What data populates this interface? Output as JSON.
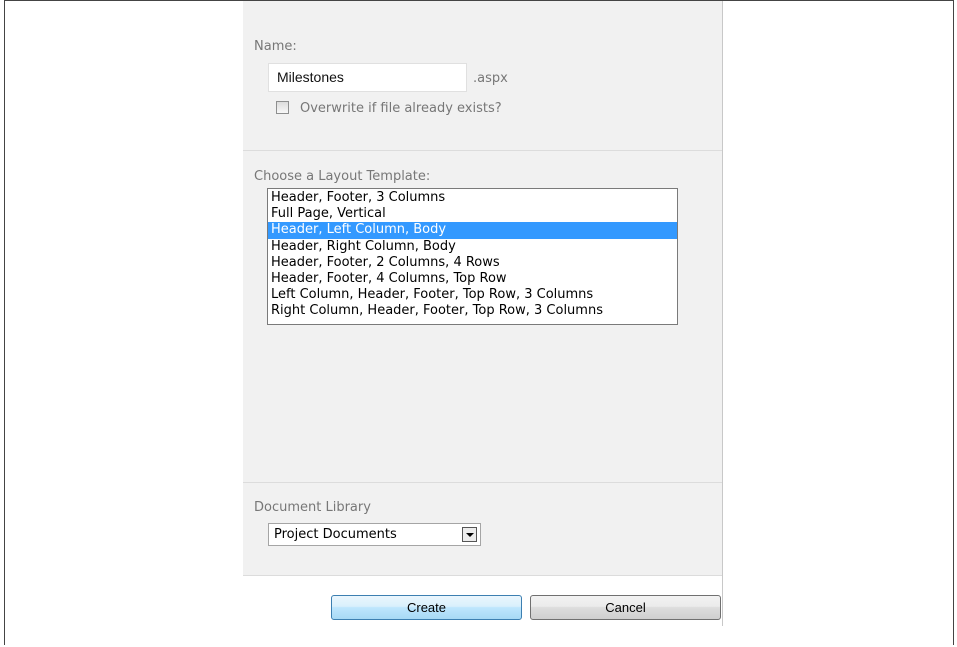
{
  "form": {
    "name_label": "Name:",
    "name_value": "Milestones",
    "extension": ".aspx",
    "overwrite_label": "Overwrite if file already exists?",
    "overwrite_checked": false
  },
  "layout": {
    "label": "Choose a Layout Template:",
    "options": [
      "Header, Footer, 3 Columns",
      "Full Page, Vertical",
      "Header, Left Column, Body",
      "Header, Right Column, Body",
      "Header, Footer, 2 Columns, 4 Rows",
      "Header, Footer, 4 Columns, Top Row",
      "Left Column, Header, Footer, Top Row, 3 Columns",
      "Right Column, Header, Footer, Top Row, 3 Columns"
    ],
    "selected": "Header, Left Column, Body"
  },
  "library": {
    "label": "Document Library",
    "selected": "Project Documents"
  },
  "buttons": {
    "create": "Create",
    "cancel": "Cancel"
  },
  "colors": {
    "selection": "#3399ff",
    "panel": "#f1f1f1"
  },
  "icons": {
    "dropdown": "chevron-down-icon"
  }
}
